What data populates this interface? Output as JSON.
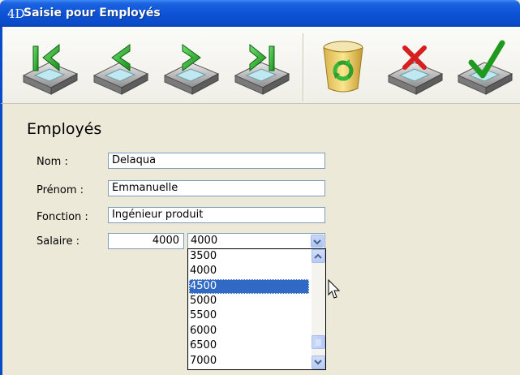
{
  "window": {
    "title_icon": "4D",
    "title": "Saisie pour  Employés"
  },
  "toolbar": {
    "buttons": [
      {
        "name": "first-record",
        "icon": "first-record-icon"
      },
      {
        "name": "previous-record",
        "icon": "previous-record-icon"
      },
      {
        "name": "next-record",
        "icon": "next-record-icon"
      },
      {
        "name": "last-record",
        "icon": "last-record-icon"
      },
      {
        "name": "delete-record",
        "icon": "trash-icon"
      },
      {
        "name": "cancel",
        "icon": "cancel-icon"
      },
      {
        "name": "validate",
        "icon": "checkmark-icon"
      }
    ]
  },
  "form": {
    "title": "Employés",
    "fields": {
      "nom": {
        "label": "Nom :",
        "value": "Delaqua"
      },
      "prenom": {
        "label": "Prénom :",
        "value": "Emmanuelle"
      },
      "fonction": {
        "label": "Fonction :",
        "value": "Ingénieur produit"
      },
      "salaire": {
        "label": "Salaire :",
        "value": "4000"
      }
    },
    "salary_combo": {
      "selected": "4000",
      "options": [
        "3500",
        "4000",
        "4500",
        "5000",
        "5500",
        "6000",
        "6500",
        "7000"
      ],
      "highlighted": "4500"
    }
  },
  "colors": {
    "titlebar": "#0a4bc9",
    "selection": "#316ac5"
  }
}
